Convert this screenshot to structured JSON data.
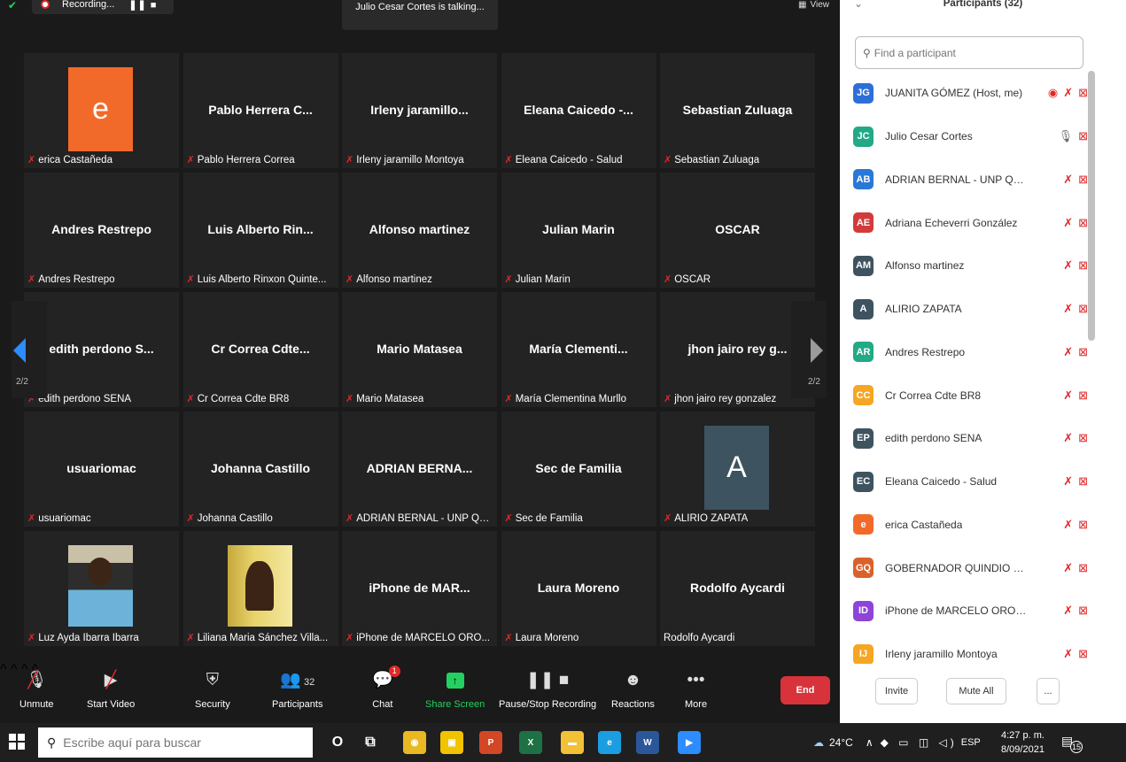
{
  "topbar": {
    "recording_label": "Recording...",
    "recording_controls": "❚❚ ■",
    "talking": "Julio Cesar Cortes is talking...",
    "view_label": "View"
  },
  "tiles": [
    {
      "big": "",
      "label": "erica Castañeda",
      "muted": true,
      "avatar": "e"
    },
    {
      "big": "Pablo Herrera C...",
      "label": "Pablo Herrera Correa",
      "muted": true
    },
    {
      "big": "Irleny jaramillo...",
      "label": "Irleny jaramillo Montoya",
      "muted": true
    },
    {
      "big": "Eleana Caicedo -...",
      "label": "Eleana Caicedo - Salud",
      "muted": true
    },
    {
      "big": "Sebastian Zuluaga",
      "label": "Sebastian Zuluaga",
      "muted": true
    },
    {
      "big": "Andres Restrepo",
      "label": "Andres Restrepo",
      "muted": true
    },
    {
      "big": "Luis Alberto Rin...",
      "label": "Luis Alberto Rinxon Quinte...",
      "muted": true
    },
    {
      "big": "Alfonso martinez",
      "label": "Alfonso martinez",
      "muted": true
    },
    {
      "big": "Julian Marin",
      "label": "Julian Marin",
      "muted": true
    },
    {
      "big": "OSCAR",
      "label": "OSCAR",
      "muted": true
    },
    {
      "big": "edith perdono S...",
      "label": "edith perdono SENA",
      "muted": true
    },
    {
      "big": "Cr Correa Cdte...",
      "label": "Cr Correa Cdte BR8",
      "muted": true
    },
    {
      "big": "Mario Matasea",
      "label": "Mario Matasea",
      "muted": true
    },
    {
      "big": "María Clementi...",
      "label": "María Clementina Murllo",
      "muted": true
    },
    {
      "big": "jhon jairo rey g...",
      "label": "jhon jairo rey gonzalez",
      "muted": true
    },
    {
      "big": "usuariomac",
      "label": "usuariomac",
      "muted": true
    },
    {
      "big": "Johanna Castillo",
      "label": "Johanna Castillo",
      "muted": true
    },
    {
      "big": "ADRIAN BERNA...",
      "label": "ADRIAN BERNAL - UNP QU...",
      "muted": true
    },
    {
      "big": "Sec de Familia",
      "label": "Sec de Familia",
      "muted": true
    },
    {
      "big": "",
      "label": "ALIRIO ZAPATA",
      "muted": true,
      "avatar": "A"
    },
    {
      "big": "",
      "label": "Luz Ayda Ibarra Ibarra",
      "muted": true,
      "photo": 1
    },
    {
      "big": "",
      "label": "Liliana Maria Sánchez Villa...",
      "muted": true,
      "photo": 2
    },
    {
      "big": "iPhone de MAR...",
      "label": "iPhone de MARCELO ORO...",
      "muted": true
    },
    {
      "big": "Laura Moreno",
      "label": "Laura Moreno",
      "muted": true
    },
    {
      "big": "Rodolfo Aycardi",
      "label": "Rodolfo Aycardi",
      "muted": false
    }
  ],
  "pagination": {
    "left": "2/2",
    "right": "2/2"
  },
  "toolbar": {
    "unmute": "Unmute",
    "start_video": "Start Video",
    "security": "Security",
    "participants": "Participants",
    "participants_count": "32",
    "chat": "Chat",
    "chat_badge": "1",
    "share_screen": "Share Screen",
    "pause_recording": "Pause/Stop Recording",
    "reactions": "Reactions",
    "more": "More",
    "end": "End"
  },
  "panel": {
    "title": "Participants (32)",
    "search_placeholder": "Find a participant",
    "participants": [
      {
        "initials": "JG",
        "name": "JUANITA GÓMEZ (Host, me)",
        "color": "#2d6fd8",
        "icons": "◉ ✗ ⊠",
        "mic": "muted"
      },
      {
        "initials": "JC",
        "name": "Julio Cesar Cortes",
        "color": "#22a985",
        "icons": "🎙 ⊠",
        "mic": "on"
      },
      {
        "initials": "AB",
        "name": "ADRIAN BERNAL - UNP QUINDI...",
        "color": "#2a78d6",
        "icons": "✗ ⊠",
        "mic": "muted"
      },
      {
        "initials": "AE",
        "name": "Adriana Echeverri González",
        "color": "#d13b3b",
        "icons": "✗ ⊠",
        "mic": "muted"
      },
      {
        "initials": "AM",
        "name": "Alfonso martinez",
        "color": "#3e5360",
        "icons": "✗ ⊠",
        "mic": "muted"
      },
      {
        "initials": "A",
        "name": "ALIRIO ZAPATA",
        "color": "#3e5360",
        "icons": "✗ ⊠",
        "mic": "muted"
      },
      {
        "initials": "AR",
        "name": "Andres Restrepo",
        "color": "#22a985",
        "icons": "✗ ⊠",
        "mic": "muted"
      },
      {
        "initials": "CC",
        "name": "Cr Correa Cdte BR8",
        "color": "#f5a623",
        "icons": "✗ ⊠",
        "mic": "muted"
      },
      {
        "initials": "EP",
        "name": "edith perdono SENA",
        "color": "#3e5360",
        "icons": "✗ ⊠",
        "mic": "muted"
      },
      {
        "initials": "EC",
        "name": "Eleana Caicedo - Salud",
        "color": "#3e5360",
        "icons": "✗ ⊠",
        "mic": "muted"
      },
      {
        "initials": "e",
        "name": "erica Castañeda",
        "color": "#f26a2a",
        "icons": "✗ ⊠",
        "mic": "muted"
      },
      {
        "initials": "GQ",
        "name": "GOBERNADOR QUINDIO ROBE...",
        "color": "#d9622b",
        "icons": "✗ ⊠",
        "mic": "muted"
      },
      {
        "initials": "ID",
        "name": "iPhone de MARCELO OROZCO",
        "color": "#8e44d8",
        "icons": "✗ ⊠",
        "mic": "muted"
      },
      {
        "initials": "IJ",
        "name": "Irleny jaramillo Montoya",
        "color": "#f5a623",
        "icons": "✗ ⊠",
        "mic": "muted"
      }
    ],
    "invite": "Invite",
    "mute_all": "Mute All",
    "more": "..."
  },
  "taskbar": {
    "search_placeholder": "Escribe aquí para buscar",
    "weather": "24°C",
    "language": "ESP",
    "time": "4:27 p. m.",
    "date": "8/09/2021",
    "notifications": "15",
    "apps": [
      {
        "name": "cortana",
        "glyph": "O",
        "color": "transparent"
      },
      {
        "name": "task-view",
        "glyph": "⧉",
        "color": "transparent"
      },
      {
        "name": "chrome",
        "glyph": "◉",
        "color": "#e8b923"
      },
      {
        "name": "store",
        "glyph": "▣",
        "color": "#f2c300"
      },
      {
        "name": "powerpoint",
        "glyph": "P",
        "color": "#d24726"
      },
      {
        "name": "excel",
        "glyph": "X",
        "color": "#1e7145"
      },
      {
        "name": "explorer",
        "glyph": "▬",
        "color": "#f3c136"
      },
      {
        "name": "edge",
        "glyph": "e",
        "color": "#1b9de2"
      },
      {
        "name": "word",
        "glyph": "W",
        "color": "#2b579a"
      },
      {
        "name": "zoom",
        "glyph": "▶",
        "color": "#2d8cff"
      }
    ]
  }
}
